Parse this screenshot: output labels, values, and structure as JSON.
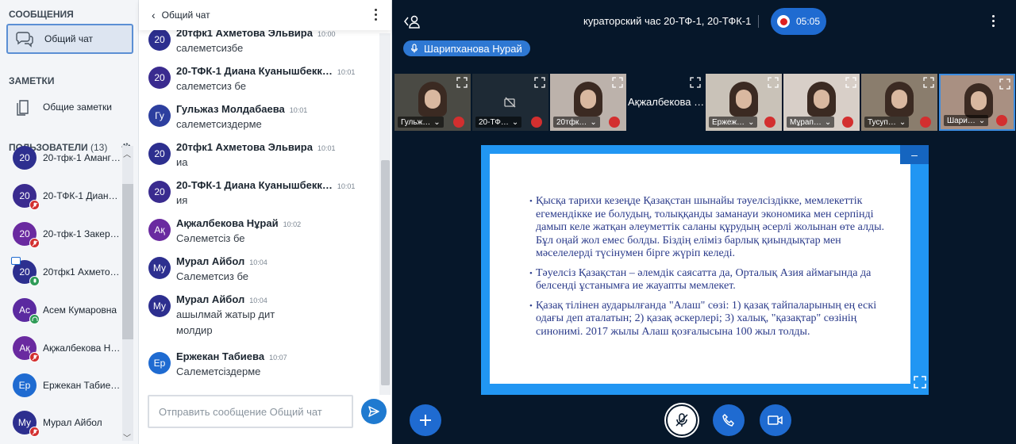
{
  "sidebar": {
    "messages_title": "СООБЩЕНИЯ",
    "public_chat": "Общий чат",
    "notes_title": "ЗАМЕТКИ",
    "shared_notes": "Общие заметки",
    "users_title": "ПОЛЬЗОВАТЕЛИ",
    "users_count": "(13)",
    "users": [
      {
        "avatar": "20",
        "name": "20-тфк-1 Аманг…",
        "color": "#2d2f8f",
        "badge": ""
      },
      {
        "avatar": "20",
        "name": "20-ТФК-1 Диана…",
        "color": "#3a2b8f",
        "badge": "muted"
      },
      {
        "avatar": "20",
        "name": "20-тфк-1 Закеро…",
        "color": "#6a2aa0",
        "badge": "muted"
      },
      {
        "avatar": "20",
        "name": "20тфк1 Ахметов…",
        "color": "#2d2f8f",
        "badge": "talking"
      },
      {
        "avatar": "Ас",
        "name": "Асем Кумаровна",
        "color": "#5b2aa0",
        "badge": "listen"
      },
      {
        "avatar": "Ақ",
        "name": "Ақжалбекова Н…",
        "color": "#6a2aa0",
        "badge": "muted"
      },
      {
        "avatar": "Ер",
        "name": "Ержекан Табие…",
        "color": "#1f6bd1",
        "badge": ""
      },
      {
        "avatar": "Му",
        "name": "Мурал Айбол",
        "color": "#2d2f8f",
        "badge": "muted"
      }
    ]
  },
  "chat": {
    "title": "Общий чат",
    "input_placeholder": "Отправить сообщение Общий чат",
    "messages": [
      {
        "avatar": "20",
        "name": "20тфк1 Ахметова Эльвира",
        "time": "10:00",
        "text": "салеметсизбе",
        "color": "#2d2f8f"
      },
      {
        "avatar": "20",
        "name": "20-ТФК-1 Диана Куанышбекк…",
        "time": "10:01",
        "text": "салеметсиз бе",
        "color": "#3a2b8f"
      },
      {
        "avatar": "Гу",
        "name": "Гульжаз Молдабаева",
        "time": "10:01",
        "text": "салеметсиздерме",
        "color": "#2d3f9f"
      },
      {
        "avatar": "20",
        "name": "20тфк1 Ахметова Эльвира",
        "time": "10:01",
        "text": "иа",
        "color": "#2d2f8f"
      },
      {
        "avatar": "20",
        "name": "20-ТФК-1 Диана Куанышбекк…",
        "time": "10:01",
        "text": "ия",
        "color": "#3a2b8f"
      },
      {
        "avatar": "Ақ",
        "name": "Ақжалбекова Нұрай",
        "time": "10:02",
        "text": "Сәлеметсіз бе",
        "color": "#6a2aa0"
      },
      {
        "avatar": "Му",
        "name": "Мурал Айбол",
        "time": "10:04",
        "text": "Салеметсиз бе",
        "color": "#2d2f8f"
      },
      {
        "avatar": "Му",
        "name": "Мурал Айбол",
        "time": "10:04",
        "text": "ашылмай жатыр дит",
        "text2": "молдир",
        "color": "#2d2f8f"
      },
      {
        "avatar": "Ер",
        "name": "Ержекан Табиева",
        "time": "10:07",
        "text": "Салеметсіздерме",
        "color": "#1f6bd1"
      }
    ]
  },
  "stage": {
    "title": "кураторский час 20-ТФ-1, 20-ТФК-1",
    "recording_time": "05:05",
    "talking_user": "Шарипханова Нурай",
    "thumbnails": [
      {
        "label": "Гульж…",
        "bg": "#4a4a44",
        "type": "video"
      },
      {
        "label": "20-ТФ…",
        "bg": "#1e2a35",
        "type": "camoff"
      },
      {
        "label": "20тфк…",
        "bg": "#bcb2ab",
        "type": "video"
      },
      {
        "label": "Ақжалбекова …",
        "bg": "#06172a",
        "type": "name"
      },
      {
        "label": "Ержеж…",
        "bg": "#c9c2b8",
        "type": "video"
      },
      {
        "label": "Мұрап…",
        "bg": "#d8cfc8",
        "type": "video"
      },
      {
        "label": "Тусуп…",
        "bg": "#8a7d6d",
        "type": "video"
      },
      {
        "label": "Шари…",
        "bg": "#a99082",
        "type": "video"
      }
    ],
    "slide_bullets": [
      "Қысқа тарихи кезеңде Қазақстан шынайы тәуелсіздікке, мемлекеттік егемендікке ие болудың, толыққанды заманауи экономика мен серпінді дамып келе жатқан әлеуметтік саланы құрудың әсерлі жолынан өте алды. Бұл оңай жол емес болды. Біздің еліміз барлық қиындықтар мен мәселелерді түсінумен бірге жүріп келеді.",
      "Тәуелсіз Қазақстан – әлемдік саясатта да, Орталық Азия аймағында да белсенді ұстанымға ие жауапты мемлекет.",
      "Қазақ тілінен аударылғанда \"Алаш\" сөзі: 1) қазақ тайпаларының ең ескі одағы деп аталатын; 2) қазақ әскерлері; 3) халық, \"қазақтар\" сөзінің синонимі. 2017 жылы Алаш қозғалысына 100 жыл толды."
    ],
    "slide_min_icon": "–"
  }
}
